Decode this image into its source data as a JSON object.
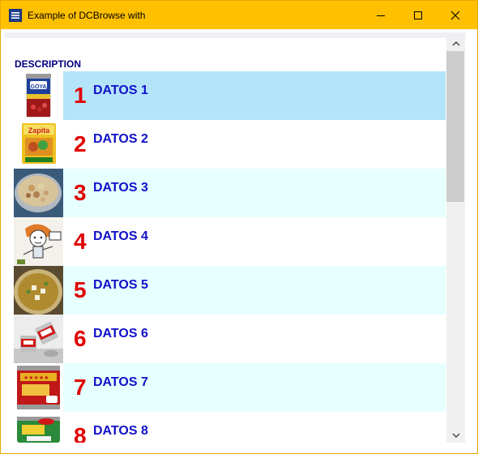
{
  "window": {
    "title": "Example of DCBrowse with"
  },
  "browse": {
    "column_header": "DESCRIPTION",
    "rows": [
      {
        "number": "1",
        "label": "DATOS 1",
        "image": "goya-can-image",
        "selected": true
      },
      {
        "number": "2",
        "label": "DATOS 2",
        "image": "sazon-packet-image"
      },
      {
        "number": "3",
        "label": "DATOS 3",
        "image": "salad-bowl-image"
      },
      {
        "number": "4",
        "label": "DATOS 4",
        "image": "cartoon-image"
      },
      {
        "number": "5",
        "label": "DATOS 5",
        "image": "soup-bowl-image"
      },
      {
        "number": "6",
        "label": "DATOS 6",
        "image": "tin-cans-image"
      },
      {
        "number": "7",
        "label": "DATOS 7",
        "image": "red-can-image"
      },
      {
        "number": "8",
        "label": "DATOS 8",
        "image": "corn-can-image"
      }
    ]
  },
  "colors": {
    "titlebar": "#ffc000",
    "selected_row": "#b4e4fa",
    "alt_row": "#e6ffff",
    "number_text": "#e00000",
    "label_text": "#1010c8"
  }
}
